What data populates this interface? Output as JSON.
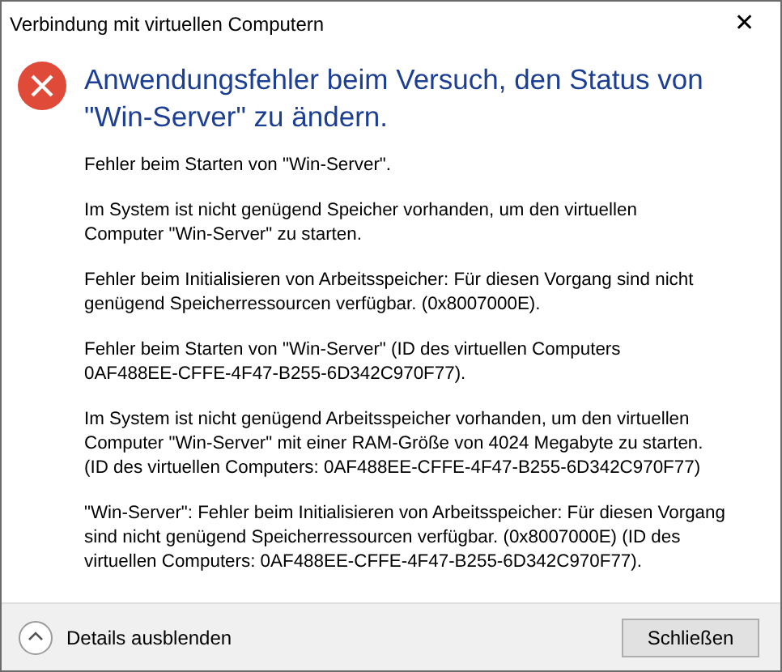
{
  "window": {
    "title": "Verbindung mit virtuellen Computern",
    "close": "✕"
  },
  "heading": {
    "lines": [
      "Anwendungsfehler beim Versuch, den Status von",
      "\"Win-Server\" zu ändern."
    ]
  },
  "paragraphs": [
    {
      "lines": [
        "Fehler beim Starten von \"Win-Server\"."
      ]
    },
    {
      "lines": [
        "Im System ist nicht genügend Speicher vorhanden, um den virtuellen",
        "Computer \"Win-Server\" zu starten."
      ]
    },
    {
      "lines": [
        "Fehler beim Initialisieren von Arbeitsspeicher: Für diesen Vorgang sind nicht",
        "genügend Speicherressourcen verfügbar. (0x8007000E)."
      ]
    },
    {
      "lines": [
        "Fehler beim Starten von \"Win-Server\" (ID des virtuellen Computers",
        "0AF488EE-CFFE-4F47-B255-6D342C970F77)."
      ]
    },
    {
      "lines": [
        "Im System ist nicht genügend Arbeitsspeicher vorhanden, um den virtuellen",
        "Computer \"Win-Server\" mit einer RAM-Größe von 4024 Megabyte zu starten.",
        "(ID des virtuellen Computers: 0AF488EE-CFFE-4F47-B255-6D342C970F77)"
      ]
    },
    {
      "lines": [
        "\"Win-Server\": Fehler beim Initialisieren von Arbeitsspeicher: Für diesen Vorgang",
        "sind nicht genügend Speicherressourcen verfügbar. (0x8007000E) (ID des",
        "virtuellen Computers: 0AF488EE-CFFE-4F47-B255-6D342C970F77)."
      ]
    }
  ],
  "footer": {
    "details_toggle": "Details ausblenden",
    "details_expanded": true,
    "button": "Schließen"
  }
}
